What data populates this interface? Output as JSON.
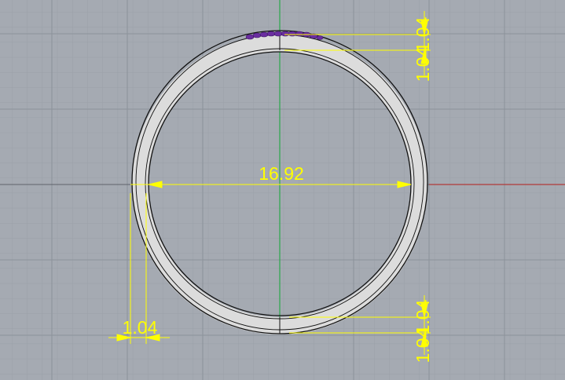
{
  "viewport": {
    "background": "#a5aab2",
    "grid_minor_color": "#9aa0a8",
    "grid_major_color": "#8c929a",
    "y_axis_color": "#2aa84a",
    "x_axis_color": "#b03a3a",
    "dimension_color": "#ffff00",
    "ring_fill": "#dcdcdc",
    "ring_outline": "#111111",
    "stone_color": "#6a2ea0"
  },
  "dimensions": {
    "inner_diameter": "16.92",
    "top_thickness": "1.04",
    "bottom_thickness": "1.04",
    "side_thickness": "1.04"
  }
}
